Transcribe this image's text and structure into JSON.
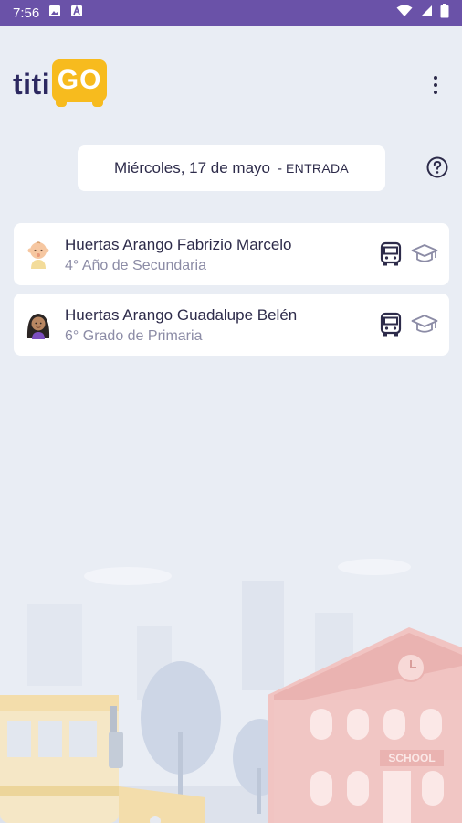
{
  "status_bar": {
    "time": "7:56",
    "left_icons": [
      "image-icon",
      "text-a-icon"
    ],
    "right_icons": [
      "wifi-icon",
      "cellular-signal-icon",
      "battery-icon"
    ]
  },
  "header": {
    "logo_prefix": "titi",
    "logo_suffix": "GO",
    "menu_icon": "more-vertical-icon"
  },
  "date_bar": {
    "date": "Miércoles, 17 de mayo",
    "separator": "-",
    "mode": "ENTRADA",
    "help_icon": "help-circle-icon"
  },
  "students": [
    {
      "name": "Huertas Arango Fabrizio Marcelo",
      "grade": "4° Año de Secundaria",
      "avatar_icon": "baby-avatar-icon",
      "icons": [
        "bus-icon",
        "graduation-cap-icon"
      ]
    },
    {
      "name": "Huertas Arango Guadalupe Belén",
      "grade": "6° Grado de Primaria",
      "avatar_icon": "girl-avatar-icon",
      "icons": [
        "bus-icon",
        "graduation-cap-icon"
      ]
    }
  ],
  "illustration": {
    "school_sign": "SCHOOL"
  },
  "colors": {
    "status_bar": "#6a52a8",
    "background": "#e9edf4",
    "brand_yellow": "#f7bb1e",
    "brand_navy": "#2c2860",
    "text_primary": "#2d2b4a",
    "text_secondary": "#8c8ca6"
  }
}
